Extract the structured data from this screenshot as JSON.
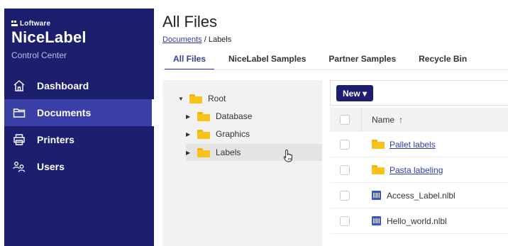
{
  "brand": {
    "company": "Loftware",
    "product": "NiceLabel",
    "sub": "Control Center"
  },
  "sidebar": {
    "items": [
      {
        "label": "Dashboard",
        "icon": "home-icon",
        "active": false
      },
      {
        "label": "Documents",
        "icon": "folder-icon",
        "active": true
      },
      {
        "label": "Printers",
        "icon": "printer-icon",
        "active": false
      },
      {
        "label": "Users",
        "icon": "users-icon",
        "active": false
      }
    ]
  },
  "header": {
    "title": "All Files",
    "breadcrumb_link": "Documents",
    "breadcrumb_sep": "/",
    "breadcrumb_current": "Labels"
  },
  "tabs": [
    {
      "label": "All Files",
      "active": true
    },
    {
      "label": "NiceLabel Samples",
      "active": false
    },
    {
      "label": "Partner Samples",
      "active": false
    },
    {
      "label": "Recycle Bin",
      "active": false
    }
  ],
  "tree": {
    "root": "Root",
    "children": [
      {
        "label": "Database"
      },
      {
        "label": "Graphics"
      },
      {
        "label": "Labels",
        "selected": true
      }
    ]
  },
  "toolbar": {
    "new_label": "New ▾"
  },
  "table": {
    "name_header": "Name",
    "sort_icon": "↑",
    "rows": [
      {
        "name": "Pallet labels",
        "type": "folder"
      },
      {
        "name": "Pasta labeling",
        "type": "folder"
      },
      {
        "name": "Access_Label.nlbl",
        "type": "label-file"
      },
      {
        "name": "Hello_world.nlbl",
        "type": "label-file"
      }
    ]
  },
  "colors": {
    "sidebar": "#1b1f6e",
    "accent": "#2f3ea8",
    "folder": "#f7c21a"
  }
}
